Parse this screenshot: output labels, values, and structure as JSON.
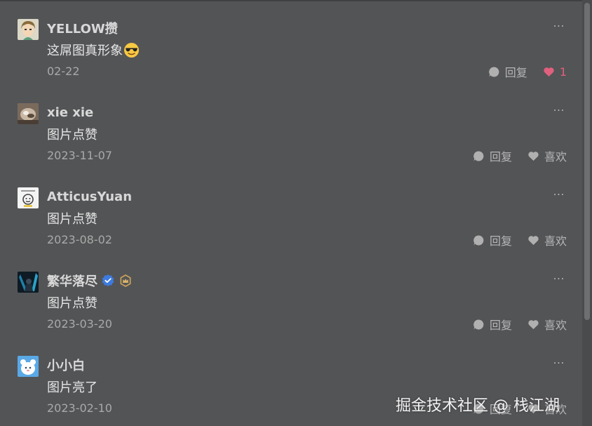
{
  "comments": [
    {
      "username": "YELLOW攒",
      "content": "这屌图真形象",
      "emoji": "sunglasses-emoji",
      "date": "02-22",
      "reply_label": "回复",
      "like_label": "1",
      "liked": true
    },
    {
      "username": "xie xie",
      "content": "图片点赞",
      "date": "2023-11-07",
      "reply_label": "回复",
      "like_label": "喜欢",
      "liked": false
    },
    {
      "username": "AtticusYuan",
      "content": "图片点赞",
      "date": "2023-08-02",
      "reply_label": "回复",
      "like_label": "喜欢",
      "liked": false
    },
    {
      "username": "繁华落尽",
      "content": "图片点赞",
      "date": "2023-03-20",
      "reply_label": "回复",
      "like_label": "喜欢",
      "liked": false,
      "badges": [
        "verified-badge-icon",
        "level-crown-badge-icon"
      ]
    },
    {
      "username": "小小白",
      "content": "图片亮了",
      "date": "2023-02-10",
      "reply_label": "回复",
      "like_label": "喜欢",
      "liked": false
    }
  ],
  "more_label": "···",
  "watermark": "掘金技术社区 @ 栈江湖",
  "colors": {
    "background": "#535456",
    "like_active": "#e0607e",
    "verified_blue": "#3d7be0",
    "crown_gold": "#c9a25a"
  }
}
